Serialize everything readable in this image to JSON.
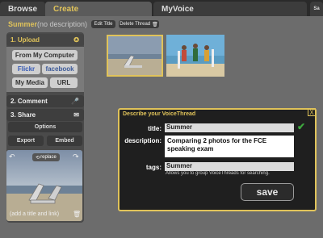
{
  "tabs": {
    "browse": "Browse",
    "create": "Create",
    "myvoice": "MyVoice",
    "small": "Sa"
  },
  "thread": {
    "title": "Summer",
    "description": "(no description)",
    "edit_title_label": "Edit Title",
    "delete_thread_label": "Delete Thread"
  },
  "upload": {
    "header": "1. Upload",
    "from_my_computer": "From My Computer",
    "flickr": "Flickr",
    "facebook": "facebook",
    "my_media": "My Media",
    "url": "URL"
  },
  "comment": {
    "header": "2. Comment"
  },
  "share": {
    "header": "3. Share"
  },
  "panel_buttons": {
    "options": "Options",
    "export": "Export",
    "embed": "Embed"
  },
  "preview": {
    "replace_label": "replace",
    "add_title_link": "(add a title and link)"
  },
  "dialog": {
    "heading": "Describe your VoiceThread",
    "close_label": "X",
    "title_label": "title:",
    "title_value": "Summer",
    "description_label": "description:",
    "description_value": "Comparing 2 photos for the FCE speaking exam",
    "tags_label": "tags:",
    "tags_value": "Summer",
    "tags_hint": "Allows you to group VoiceThreads for searching.",
    "save_label": "save"
  },
  "colors": {
    "accent": "#e0c35a",
    "check": "#3ea83e"
  }
}
